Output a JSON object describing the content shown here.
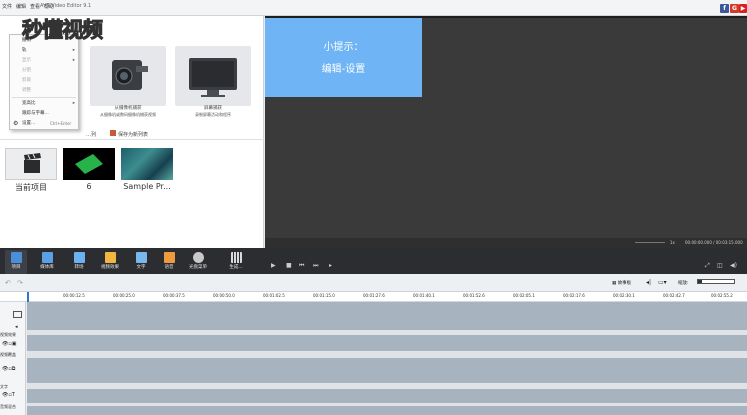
{
  "titlebar": {
    "menus": [
      "文件",
      "编辑",
      "查看",
      "帮助"
    ],
    "title": "AVS Video Editor 9.1",
    "social": [
      {
        "icon": "facebook-icon",
        "glyph": "f",
        "color": "#3b5998"
      },
      {
        "icon": "google-plus-icon",
        "glyph": "G",
        "color": "#d23b2a"
      },
      {
        "icon": "youtube-icon",
        "glyph": "▶",
        "color": "#d8211e"
      }
    ]
  },
  "watermark": "秒懂视频",
  "context_menu": [
    {
      "label": "撤消",
      "disabled": false,
      "arrow": false,
      "shortcut": ""
    },
    {
      "label": "轨",
      "disabled": false,
      "arrow": true,
      "shortcut": ""
    },
    {
      "label": "显示",
      "disabled": true,
      "arrow": true,
      "shortcut": ""
    },
    {
      "label": "分割",
      "disabled": true,
      "arrow": false,
      "shortcut": ""
    },
    {
      "label": "剪裁",
      "disabled": true,
      "arrow": false,
      "shortcut": ""
    },
    {
      "label": "调整",
      "disabled": true,
      "arrow": false,
      "shortcut": ""
    },
    {
      "label": "宽高比",
      "disabled": false,
      "arrow": true,
      "shortcut": ""
    },
    {
      "label": "跟踪与字幕...",
      "disabled": false,
      "arrow": false,
      "shortcut": ""
    },
    {
      "label": "设置...",
      "disabled": false,
      "arrow": false,
      "shortcut": "Ctrl+Enter"
    }
  ],
  "capture_cards": [
    {
      "title": "从摄像机捕获",
      "subtitle": "从摄像机或数码摄像机捕获视频"
    },
    {
      "title": "屏幕捕获",
      "subtitle": "录制屏幕活动和程序"
    }
  ],
  "media_tabs": [
    "…列",
    "保存为新列表"
  ],
  "media_items": [
    {
      "label": "当前项目"
    },
    {
      "label": "6"
    },
    {
      "label": "Sample Pr..."
    }
  ],
  "tip": {
    "line1": "小提示：",
    "line2": "编辑-设置"
  },
  "preview": {
    "speed": "1x",
    "time": "00:00:00.000 / 00:03:15.000"
  },
  "toolbar": [
    {
      "label": "项目",
      "icon": "project-icon",
      "color": "#4a90d9",
      "active": true
    },
    {
      "label": "媒体库",
      "icon": "library-icon",
      "color": "#5aa0e6",
      "active": false
    },
    {
      "label": "转场",
      "icon": "transition-icon",
      "color": "#6bb3f0",
      "active": false
    },
    {
      "label": "视频效果",
      "icon": "video-effect-icon",
      "color": "#f0b640",
      "active": false
    },
    {
      "label": "文字",
      "icon": "text-icon",
      "color": "#79b8ef",
      "active": false
    },
    {
      "label": "语音",
      "icon": "voice-icon",
      "color": "#f09a40",
      "active": false
    },
    {
      "label": "光盘菜单",
      "icon": "disc-menu-icon",
      "color": "#c9c9c9",
      "active": false
    },
    {
      "label": "生成...",
      "icon": "produce-icon",
      "color": "#dadada",
      "active": false
    }
  ],
  "timeline": {
    "storyboard_label": "故事板",
    "zoom_label": "缩放:",
    "ticks": [
      "00:00:12.5",
      "00:00:25.0",
      "00:00:37.5",
      "00:00:50.0",
      "00:01:02.5",
      "00:01:15.0",
      "00:01:27.6",
      "00:01:40.1",
      "00:01:52.6",
      "00:02:05.1",
      "00:02:17.6",
      "00:02:30.1",
      "00:02:42.7",
      "00:02:55.2"
    ],
    "tracks": [
      "视频效果",
      "视频覆盖",
      "文字",
      "音频混合"
    ]
  }
}
